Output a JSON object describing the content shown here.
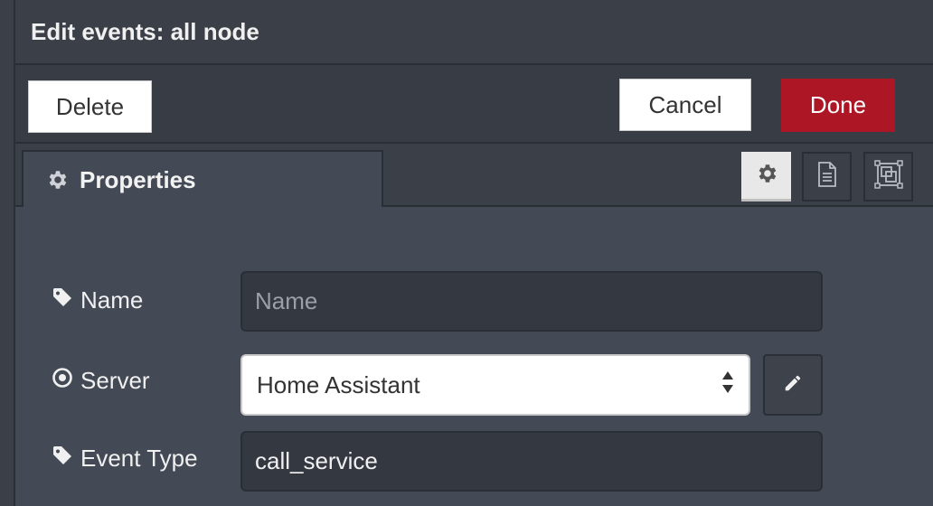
{
  "tray": {
    "title": "Edit events: all node"
  },
  "toolbar": {
    "delete_label": "Delete",
    "cancel_label": "Cancel",
    "done_label": "Done"
  },
  "tabs": {
    "properties_label": "Properties",
    "icons": [
      "gear-icon",
      "document-icon",
      "frame-icon"
    ]
  },
  "form": {
    "name": {
      "label": "Name",
      "placeholder": "Name",
      "value": ""
    },
    "server": {
      "label": "Server",
      "value": "Home Assistant"
    },
    "event_type": {
      "label": "Event Type",
      "value": "call_service"
    }
  },
  "colors": {
    "accent_done": "#ad1625",
    "background": "#434955",
    "header": "#3a3f48"
  }
}
